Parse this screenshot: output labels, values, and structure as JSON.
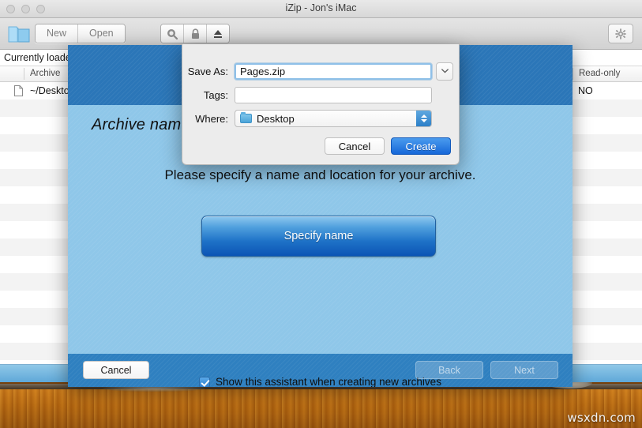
{
  "window": {
    "title": "iZip - Jon's iMac",
    "traffic_lights": [
      "close",
      "minimize",
      "zoom"
    ]
  },
  "toolbar": {
    "folder_icon": "folder-icon",
    "segments": [
      {
        "label": "New",
        "name": "new-button"
      },
      {
        "label": "Open",
        "name": "open-button"
      }
    ],
    "icons": [
      {
        "name": "search-icon",
        "glyph": "search"
      },
      {
        "name": "lock-icon",
        "glyph": "lock"
      },
      {
        "name": "eject-icon",
        "glyph": "eject"
      }
    ],
    "gear": {
      "name": "gear-icon",
      "glyph": "gear"
    }
  },
  "status": {
    "loaded_text": "Currently loaded"
  },
  "table": {
    "columns": [
      {
        "label": "Archive",
        "name": "column-archive"
      },
      {
        "label": "Read-only",
        "name": "column-read-only"
      }
    ],
    "rows": [
      {
        "archive": "~/Desktop",
        "read_only": "NO"
      }
    ],
    "empty_row_count": 15
  },
  "assistant": {
    "title": "Archive name",
    "subtitle": "Please specify a name and location for your archive.",
    "specify_button": "Specify name",
    "checkbox_label": "Show this assistant when creating new archives",
    "checkbox_checked": true,
    "cancel_button": "Cancel",
    "back_button": "Back",
    "next_button": "Next",
    "colors": {
      "header": "#2b76b8",
      "body": "#8fc7e9",
      "footer": "#2f80c0",
      "accent": "#1f73c8"
    }
  },
  "save_sheet": {
    "save_as_label": "Save As:",
    "save_as_value": "Pages.zip",
    "tags_label": "Tags:",
    "tags_value": "",
    "tags_placeholder": "",
    "where_label": "Where:",
    "where_value": "Desktop",
    "cancel_button": "Cancel",
    "create_button": "Create",
    "disclosure_icon": "chevron-down-icon"
  },
  "desktop": {
    "watermark": "wsxdn.com"
  }
}
